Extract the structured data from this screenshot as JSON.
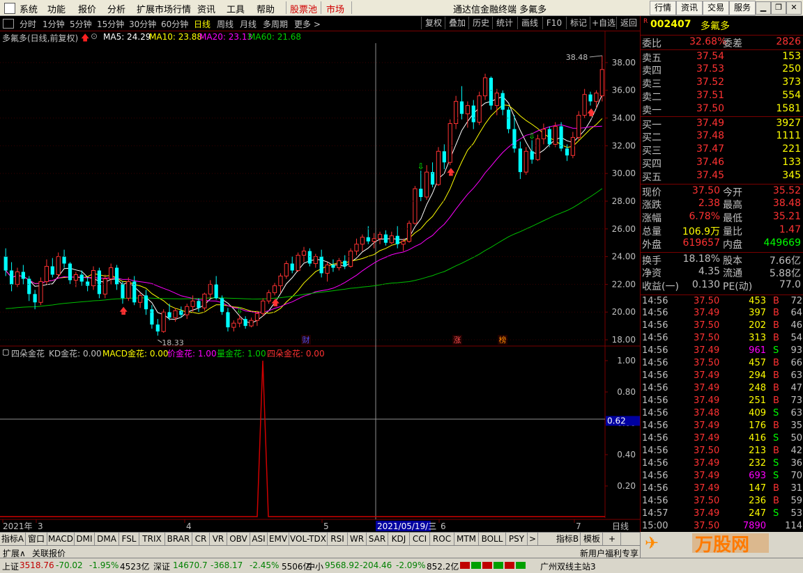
{
  "menu": {
    "items": [
      "系统",
      "功能",
      "报价",
      "分析",
      "扩展市场行情",
      "资讯",
      "工具",
      "帮助"
    ],
    "stock_pool": "股票池",
    "market": "市场",
    "title": "通达信金融终端 多氟多",
    "right_buttons": [
      "行情",
      "资讯",
      "交易",
      "服务"
    ]
  },
  "periods": [
    "分时",
    "1分钟",
    "5分钟",
    "15分钟",
    "30分钟",
    "60分钟",
    "日线",
    "周线",
    "月线",
    "多周期",
    "更多 >"
  ],
  "active_period": "日线",
  "toolbar": [
    "复权",
    "叠加",
    "历史",
    "统计",
    "画线",
    "F10",
    "标记",
    "+自选",
    "返回"
  ],
  "header": {
    "name": "多氟多(日线,前复权)",
    "ma5": "MA5: 24.29",
    "ma10": "MA10: 23.88",
    "ma20": "MA20: 23.13",
    "ma60": "MA60: 21.68"
  },
  "indicator_header": {
    "name": "四朵金花",
    "kd": "KD金花: 0.00",
    "macd": "MACD金花: 0.00",
    "price": "价金花: 1.00",
    "vol": "量金花: 1.00",
    "four": "四朵金花: 0.00"
  },
  "chart_data": {
    "type": "candlestick",
    "y_ticks": [
      "38.00",
      "36.00",
      "34.00",
      "32.00",
      "30.00",
      "28.00",
      "26.00",
      "24.00",
      "22.00",
      "20.00",
      "18.00"
    ],
    "ylim": [
      17.6,
      39.2
    ],
    "high_label": "38.48",
    "low_label": "18.33",
    "markers": [
      "财",
      "涨",
      "榜"
    ],
    "x_labels": [
      "2021年",
      "3",
      "4",
      "5",
      "2021/05/19/三",
      "6",
      "7"
    ],
    "ind_ticks": [
      "1.00",
      "0.80",
      "0.60",
      "0.40",
      "0.20"
    ],
    "ind_current": "0.62",
    "candles": [
      [
        24.0,
        24.6,
        22.6,
        23.0
      ],
      [
        23.0,
        23.6,
        21.5,
        22.0
      ],
      [
        22.0,
        23.2,
        21.8,
        22.9
      ],
      [
        22.9,
        23.4,
        22.0,
        22.4
      ],
      [
        22.4,
        22.6,
        20.8,
        21.3
      ],
      [
        21.3,
        21.6,
        20.2,
        20.7
      ],
      [
        20.7,
        22.5,
        20.5,
        22.2
      ],
      [
        22.2,
        23.8,
        22.0,
        23.3
      ],
      [
        23.3,
        23.9,
        22.5,
        22.7
      ],
      [
        22.7,
        24.3,
        22.5,
        24.0
      ],
      [
        24.0,
        24.5,
        23.2,
        23.5
      ],
      [
        23.5,
        23.6,
        22.0,
        22.3
      ],
      [
        22.3,
        22.9,
        21.8,
        22.7
      ],
      [
        22.7,
        23.0,
        21.9,
        22.2
      ],
      [
        22.2,
        22.5,
        21.5,
        21.9
      ],
      [
        21.9,
        23.3,
        21.6,
        23.0
      ],
      [
        23.0,
        23.2,
        21.0,
        21.3
      ],
      [
        21.3,
        22.7,
        21.0,
        22.4
      ],
      [
        22.4,
        23.5,
        22.0,
        23.2
      ],
      [
        23.2,
        23.4,
        21.6,
        22.0
      ],
      [
        22.0,
        22.2,
        20.6,
        21.0
      ],
      [
        21.0,
        22.5,
        20.8,
        22.2
      ],
      [
        22.2,
        22.6,
        20.5,
        20.7
      ],
      [
        20.7,
        21.4,
        20.3,
        21.2
      ],
      [
        21.2,
        21.6,
        19.8,
        20.2
      ],
      [
        20.2,
        20.5,
        18.8,
        19.1
      ],
      [
        19.1,
        19.5,
        18.3,
        18.6
      ],
      [
        18.6,
        20.2,
        18.5,
        20.0
      ],
      [
        20.0,
        20.6,
        19.4,
        19.6
      ],
      [
        19.6,
        20.3,
        19.3,
        20.1
      ],
      [
        20.1,
        20.4,
        19.6,
        19.8
      ],
      [
        19.8,
        20.6,
        19.5,
        20.4
      ],
      [
        20.4,
        21.2,
        20.0,
        20.8
      ],
      [
        20.8,
        21.0,
        20.0,
        20.3
      ],
      [
        20.3,
        21.4,
        20.1,
        21.3
      ],
      [
        21.3,
        22.3,
        21.0,
        22.0
      ],
      [
        22.0,
        22.6,
        20.9,
        21.0
      ],
      [
        21.0,
        21.2,
        19.8,
        20.0
      ],
      [
        20.0,
        20.3,
        18.6,
        18.9
      ],
      [
        18.9,
        19.4,
        18.6,
        19.2
      ],
      [
        19.2,
        19.8,
        18.9,
        19.5
      ],
      [
        19.5,
        19.7,
        18.8,
        19.0
      ],
      [
        19.0,
        19.6,
        18.9,
        19.4
      ],
      [
        19.4,
        20.1,
        19.0,
        19.9
      ],
      [
        19.9,
        21.0,
        19.7,
        20.8
      ],
      [
        20.8,
        21.6,
        20.6,
        21.4
      ],
      [
        21.4,
        22.1,
        21.2,
        21.9
      ],
      [
        21.9,
        22.8,
        21.4,
        22.6
      ],
      [
        22.6,
        23.7,
        22.4,
        23.5
      ],
      [
        23.5,
        24.0,
        22.8,
        23.0
      ],
      [
        23.0,
        24.3,
        22.9,
        24.1
      ],
      [
        24.1,
        24.7,
        23.6,
        24.4
      ],
      [
        24.4,
        24.6,
        23.3,
        23.5
      ],
      [
        23.5,
        24.2,
        23.2,
        24.0
      ],
      [
        24.0,
        24.5,
        22.5,
        22.8
      ],
      [
        22.8,
        23.6,
        22.2,
        23.4
      ],
      [
        23.4,
        23.8,
        22.9,
        23.2
      ],
      [
        23.2,
        23.9,
        23.0,
        23.7
      ],
      [
        23.7,
        24.1,
        23.1,
        23.3
      ],
      [
        23.3,
        24.6,
        23.2,
        24.4
      ],
      [
        24.4,
        25.3,
        24.1,
        24.9
      ],
      [
        24.9,
        25.6,
        24.4,
        25.4
      ],
      [
        25.4,
        26.2,
        24.9,
        25.1
      ],
      [
        25.1,
        25.7,
        24.6,
        25.3
      ],
      [
        25.3,
        25.8,
        24.9,
        25.6
      ],
      [
        25.6,
        25.9,
        24.8,
        25.0
      ],
      [
        25.0,
        25.8,
        24.9,
        25.5
      ],
      [
        25.5,
        26.2,
        24.6,
        24.9
      ],
      [
        24.9,
        25.3,
        24.4,
        25.1
      ],
      [
        25.1,
        26.6,
        25.0,
        26.4
      ],
      [
        26.4,
        29.1,
        26.3,
        28.9
      ],
      [
        28.9,
        30.2,
        28.0,
        28.3
      ],
      [
        28.3,
        30.6,
        28.1,
        30.1
      ],
      [
        30.1,
        30.8,
        29.0,
        29.2
      ],
      [
        29.2,
        31.9,
        29.1,
        31.6
      ],
      [
        31.6,
        32.1,
        30.3,
        30.8
      ],
      [
        30.8,
        33.9,
        30.6,
        33.6
      ],
      [
        33.6,
        35.6,
        33.2,
        35.2
      ],
      [
        35.2,
        36.3,
        33.9,
        34.3
      ],
      [
        34.3,
        35.2,
        33.3,
        34.9
      ],
      [
        34.9,
        35.3,
        33.2,
        33.7
      ],
      [
        33.7,
        35.9,
        33.5,
        35.6
      ],
      [
        35.6,
        37.2,
        35.3,
        36.9
      ],
      [
        36.9,
        37.0,
        34.6,
        34.9
      ],
      [
        34.9,
        36.1,
        34.2,
        35.8
      ],
      [
        35.8,
        36.0,
        34.2,
        34.6
      ],
      [
        34.6,
        34.8,
        32.9,
        33.2
      ],
      [
        33.2,
        34.2,
        31.5,
        31.8
      ],
      [
        31.8,
        32.3,
        29.6,
        30.1
      ],
      [
        30.1,
        31.9,
        29.9,
        31.6
      ],
      [
        31.6,
        32.4,
        30.7,
        31.0
      ],
      [
        31.0,
        32.8,
        30.9,
        32.5
      ],
      [
        32.5,
        33.6,
        32.1,
        33.2
      ],
      [
        33.2,
        33.4,
        31.9,
        32.1
      ],
      [
        32.1,
        33.7,
        31.9,
        33.4
      ],
      [
        33.4,
        33.7,
        31.6,
        31.8
      ],
      [
        31.8,
        32.1,
        30.9,
        31.3
      ],
      [
        31.3,
        33.0,
        31.1,
        32.6
      ],
      [
        32.6,
        34.5,
        32.4,
        34.2
      ],
      [
        34.2,
        36.1,
        34.0,
        35.7
      ],
      [
        35.7,
        35.9,
        34.9,
        35.2
      ],
      [
        35.2,
        36.0,
        34.7,
        35.8
      ],
      [
        35.6,
        38.5,
        35.2,
        37.5
      ]
    ]
  },
  "quote": {
    "code": "002407",
    "name": "多氟多",
    "weibi_label": "委比",
    "weibi": "32.68%",
    "weicha_label": "委差",
    "weicha": "2826",
    "asks": [
      [
        "卖五",
        "37.54",
        "153"
      ],
      [
        "卖四",
        "37.53",
        "250"
      ],
      [
        "卖三",
        "37.52",
        "373"
      ],
      [
        "卖二",
        "37.51",
        "554"
      ],
      [
        "卖一",
        "37.50",
        "1581"
      ]
    ],
    "bids": [
      [
        "买一",
        "37.49",
        "3927"
      ],
      [
        "买二",
        "37.48",
        "1111"
      ],
      [
        "买三",
        "37.47",
        "221"
      ],
      [
        "买四",
        "37.46",
        "133"
      ],
      [
        "买五",
        "37.45",
        "345"
      ]
    ],
    "stats": [
      [
        "现价",
        "37.50",
        "今开",
        "35.52"
      ],
      [
        "涨跌",
        "2.38",
        "最高",
        "38.48"
      ],
      [
        "涨幅",
        "6.78%",
        "最低",
        "35.21"
      ],
      [
        "总量",
        "106.9万",
        "量比",
        "1.47"
      ],
      [
        "外盘",
        "619657",
        "内盘",
        "449669"
      ],
      [
        "换手",
        "18.18%",
        "股本",
        "7.66亿"
      ],
      [
        "净资",
        "4.35",
        "流通",
        "5.88亿"
      ],
      [
        "收益(一)",
        "0.130",
        "PE(动)",
        "77.0"
      ]
    ],
    "ticks": [
      [
        "14:56",
        "37.50",
        "453",
        "B",
        "72"
      ],
      [
        "14:56",
        "37.49",
        "397",
        "B",
        "64"
      ],
      [
        "14:56",
        "37.50",
        "202",
        "B",
        "46"
      ],
      [
        "14:56",
        "37.50",
        "313",
        "B",
        "54"
      ],
      [
        "14:56",
        "37.49",
        "961",
        "S",
        "93"
      ],
      [
        "14:56",
        "37.50",
        "457",
        "B",
        "66"
      ],
      [
        "14:56",
        "37.49",
        "294",
        "B",
        "63"
      ],
      [
        "14:56",
        "37.49",
        "248",
        "B",
        "47"
      ],
      [
        "14:56",
        "37.49",
        "251",
        "B",
        "73"
      ],
      [
        "14:56",
        "37.48",
        "409",
        "S",
        "63"
      ],
      [
        "14:56",
        "37.49",
        "176",
        "B",
        "35"
      ],
      [
        "14:56",
        "37.49",
        "416",
        "S",
        "50"
      ],
      [
        "14:56",
        "37.50",
        "213",
        "B",
        "42"
      ],
      [
        "14:56",
        "37.49",
        "232",
        "S",
        "36"
      ],
      [
        "14:56",
        "37.49",
        "693",
        "S",
        "70"
      ],
      [
        "14:56",
        "37.49",
        "147",
        "B",
        "31"
      ],
      [
        "14:56",
        "37.50",
        "236",
        "B",
        "59"
      ],
      [
        "14:57",
        "37.49",
        "247",
        "S",
        "53"
      ],
      [
        "15:00",
        "37.50",
        "7890",
        "",
        "114"
      ]
    ]
  },
  "indicator_tabs": [
    "指标A",
    "窗口",
    "MACD",
    "DMI",
    "DMA",
    "FSL",
    "TRIX",
    "BRAR",
    "CR",
    "VR",
    "OBV",
    "ASI",
    "EMV",
    "VOL-TDX",
    "RSI",
    "WR",
    "SAR",
    "KDJ",
    "CCI",
    "ROC",
    "MTM",
    "BOLL",
    "PSY"
  ],
  "indicator_right": [
    "指标B",
    "模板",
    "+"
  ],
  "ext_left": [
    "扩展∧",
    "关联报价"
  ],
  "ext_right": "新用户福利专享",
  "status": {
    "sh_label": "上证",
    "sh": "3518.76",
    "sh_chg": "-70.02",
    "sh_pct": "-1.95%",
    "sh_amt": "4523亿",
    "sz_label": "深证",
    "sz": "14670.7",
    "sz_chg": "-368.17",
    "sz_pct": "-2.45%",
    "sz_amt": "5506亿",
    "zx_label": "中小",
    "zx": "9568.92",
    "zx_chg": "-204.46",
    "zx_pct": "-2.09%",
    "zx_amt": "852.2亿",
    "server": "广州双线主站3"
  },
  "period_label": "日线",
  "colors": {
    "up": "#ff3232",
    "down": "#00ffff",
    "ma5": "#ffffff",
    "ma10": "#ffff00",
    "ma20": "#ff00ff",
    "ma60": "#00c000",
    "bg": "#000000",
    "frame": "#7a0000"
  }
}
